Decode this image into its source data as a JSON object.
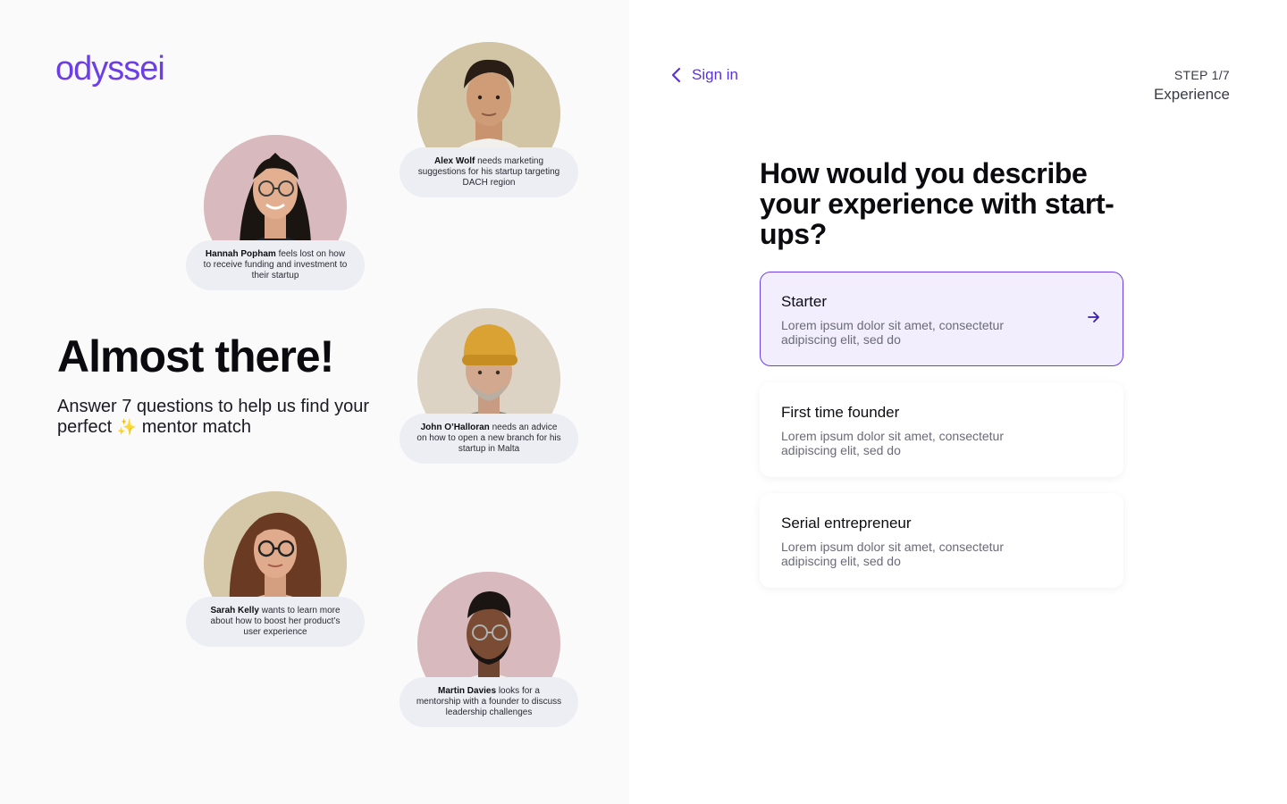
{
  "brand": {
    "logo": "odyssei",
    "accent": "#6b3ee8"
  },
  "hero": {
    "title": "Almost there!",
    "subtitle_before": "Answer 7 questions to help us find your perfect",
    "subtitle_emoji": "✨",
    "subtitle_after": "mentor match"
  },
  "mentors": [
    {
      "name": "Alex Wolf",
      "text": "needs marketing suggestions for his startup targeting DACH region",
      "bg": "#d2c5a6"
    },
    {
      "name": "Hannah Popham",
      "text": "feels lost on how to receive funding and investment to their startup",
      "bg": "#d8b9be"
    },
    {
      "name": "John O’Halloran",
      "text": "needs an advice on how to open a new branch for his startup in Malta",
      "bg": "#ddd3c4"
    },
    {
      "name": "Sarah Kelly",
      "text": "wants to learn more about how to boost her product’s user experience",
      "bg": "#d5c8a8"
    },
    {
      "name": "Martin Davies",
      "text": "looks for a mentorship with a founder to discuss leadership challenges",
      "bg": "#d8b9be"
    }
  ],
  "nav": {
    "back_label": "Sign in",
    "step_count": "STEP 1/7",
    "step_name": "Experience"
  },
  "question": "How would you describe your experience with start-ups?",
  "options": [
    {
      "title": "Starter",
      "description": "Lorem ipsum dolor sit amet, consectetur adipiscing elit, sed do",
      "selected": true
    },
    {
      "title": "First time founder",
      "description": "Lorem ipsum dolor sit amet, consectetur adipiscing elit, sed do",
      "selected": false
    },
    {
      "title": "Serial entrepreneur",
      "description": "Lorem ipsum dolor sit amet, consectetur adipiscing elit, sed do",
      "selected": false
    }
  ]
}
